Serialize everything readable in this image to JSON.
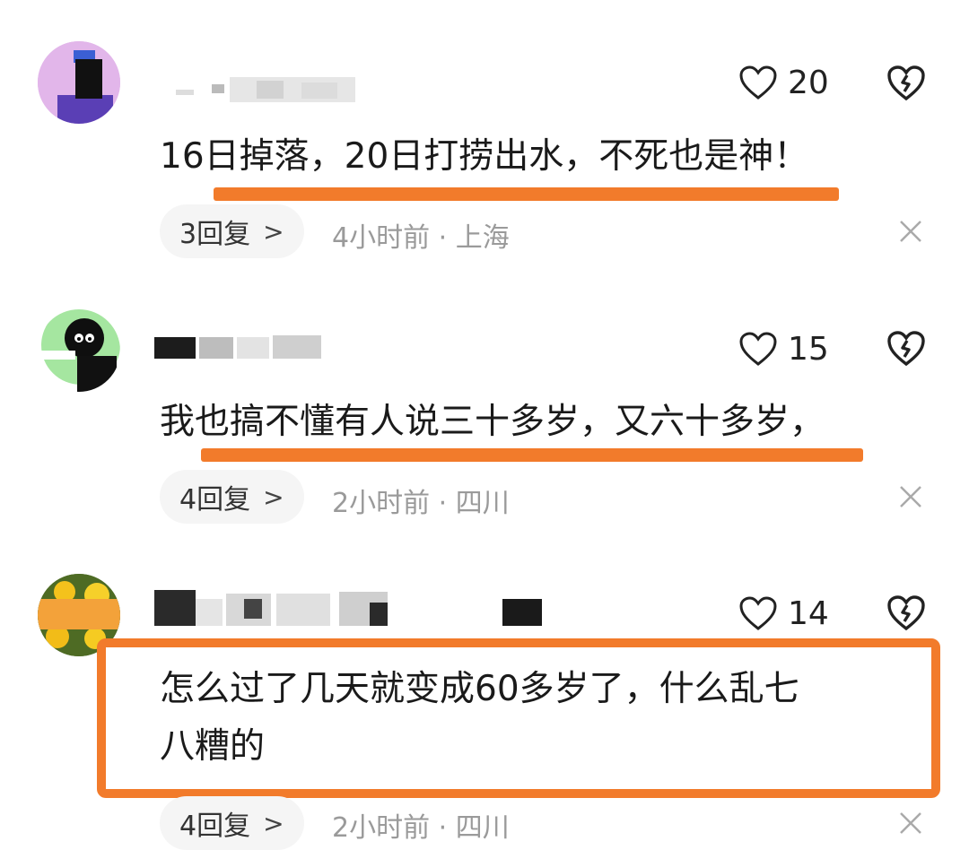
{
  "comments": [
    {
      "likes": "20",
      "text": "16日掉落，20日打捞出水，不死也是神！",
      "replies": "3回复",
      "time": "4小时前",
      "location": "上海"
    },
    {
      "likes": "15",
      "text": "我也搞不懂有人说三十多岁，又六十多岁，",
      "replies": "4回复",
      "time": "2小时前",
      "location": "四川"
    },
    {
      "likes": "14",
      "text_line1": "怎么过了几天就变成60多岁了，什么乱七",
      "text_line2": "八糟的",
      "replies": "4回复",
      "time": "2小时前",
      "location": "四川"
    }
  ],
  "separator": "·",
  "icons": {
    "like": "heart-icon",
    "dislike": "broken-heart-icon",
    "more": "chevron-right-icon",
    "close": "close-icon"
  },
  "colors": {
    "highlight": "#f27b2b",
    "meta": "#9a9a9a",
    "pill": "#f5f5f5"
  }
}
